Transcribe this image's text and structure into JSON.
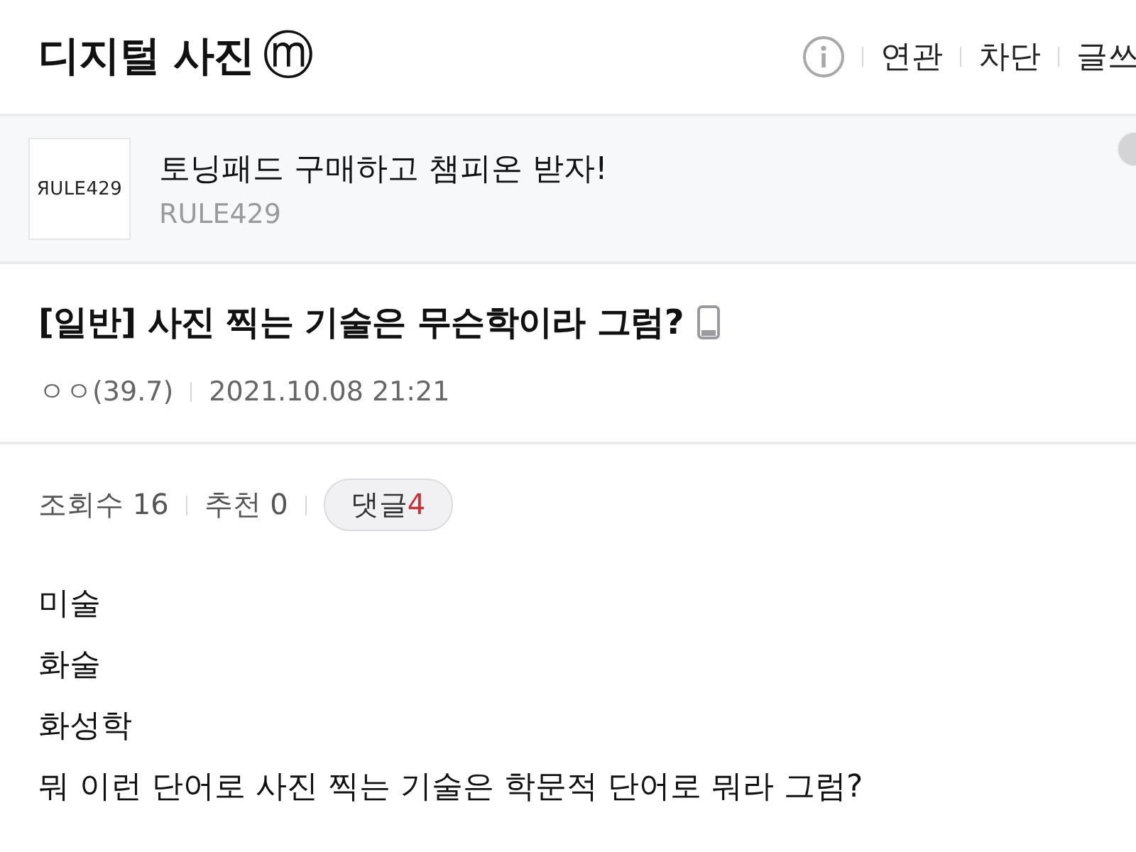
{
  "header": {
    "title": "디지털 사진",
    "gallery_mark": "ⓜ",
    "actions": [
      {
        "label": "연관"
      },
      {
        "label": "차단"
      },
      {
        "label": "글쓰"
      }
    ]
  },
  "ad": {
    "logo_text": "ЯULE429",
    "title": "토닝패드 구매하고 챔피온 받자!",
    "advertiser": "RULE429"
  },
  "post": {
    "title": "[일반] 사진 찍는 기술은 무슨학이라 그럼?",
    "mobile": true,
    "author": "ㅇㅇ(39.7)",
    "date": "2021.10.08 21:21"
  },
  "stats": [
    {
      "text": "조회수 16"
    },
    {
      "text": "추천 0"
    }
  ],
  "comments": {
    "label": "댓글",
    "count": "4"
  },
  "body": [
    "미술",
    "화술",
    "화성학",
    "뭐 이런 단어로 사진 찍는 기술은 학문적 단어로 뭐라 그럼?"
  ]
}
